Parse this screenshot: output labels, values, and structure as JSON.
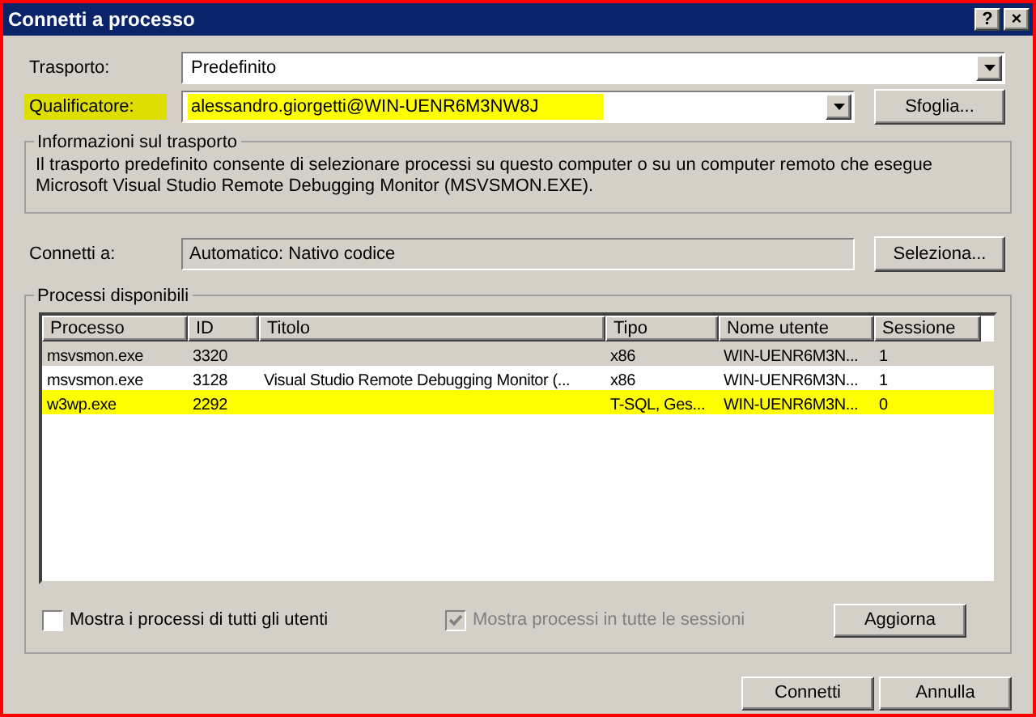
{
  "window": {
    "title": "Connetti a processo",
    "buttons": [
      "?",
      "×"
    ]
  },
  "transport": {
    "label": "Trasporto:",
    "value": "Predefinito"
  },
  "qualifier": {
    "label": "Qualificatore:",
    "value": "alessandro.giorgetti@WIN-UENR6M3NW8J",
    "highlighted": true,
    "button": "Sfoglia..."
  },
  "transport_info": {
    "title": "Informazioni sul trasporto",
    "text": "Il trasporto predefinito consente di selezionare processi su questo computer o su un computer remoto che esegue Microsoft Visual Studio Remote Debugging Monitor (MSVSMON.EXE)."
  },
  "connect_to": {
    "label": "Connetti a:",
    "value": "Automatico: Nativo codice",
    "button": "Seleziona..."
  },
  "processes": {
    "title": "Processi disponibili",
    "columns": [
      "Processo",
      "ID",
      "Titolo",
      "Tipo",
      "Nome utente",
      "Sessione"
    ],
    "rows": [
      {
        "cells": [
          "msvsmon.exe",
          "3320",
          "",
          "x86",
          "WIN-UENR6M3N...",
          "1"
        ],
        "selected": true,
        "highlighted": false
      },
      {
        "cells": [
          "msvsmon.exe",
          "3128",
          "Visual Studio Remote Debugging Monitor (...",
          "x86",
          "WIN-UENR6M3N...",
          "1"
        ],
        "selected": false,
        "highlighted": false
      },
      {
        "cells": [
          "w3wp.exe",
          "2292",
          "",
          "T-SQL, Ges...",
          "WIN-UENR6M3N...",
          "0"
        ],
        "selected": false,
        "highlighted": true
      }
    ],
    "options": [
      {
        "label": "Mostra i processi di tutti gli utenti",
        "checked": false,
        "disabled": false
      },
      {
        "label": "Mostra processi in tutte le sessioni",
        "checked": true,
        "disabled": true
      }
    ],
    "refresh_button": "Aggiorna"
  },
  "buttons": [
    "Connetti",
    "Annulla"
  ]
}
